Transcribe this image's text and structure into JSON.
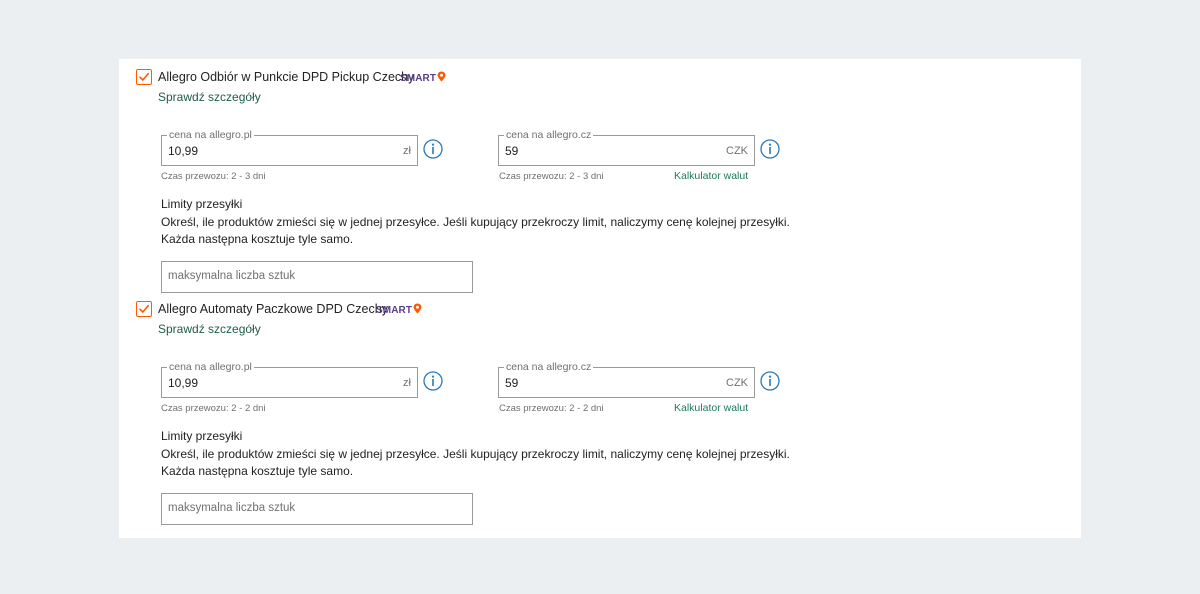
{
  "colors": {
    "accent_checkbox": "#ff5a00",
    "link_green": "#1f5c4a",
    "calc_link_green": "#1f7a5c",
    "info_icon_blue": "#2a7ab8",
    "smart_purple": "#5a3e8a",
    "page_bg": "#eceff2"
  },
  "shipping_methods": [
    {
      "checked": true,
      "title": "Allegro Odbiór w Punkcie DPD Pickup Czechy",
      "badge": "SMART",
      "details_link": "Sprawdź szczegóły",
      "price_pl": {
        "legend": "cena na allegro.pl",
        "value": "10,99",
        "unit": "zł",
        "transit": "Czas przewozu: 2 - 3 dni"
      },
      "price_cz": {
        "legend": "cena na allegro.cz",
        "value": "59",
        "unit": "CZK",
        "transit": "Czas przewozu: 2 - 3 dni",
        "calculator_link": "Kalkulator walut"
      },
      "limits": {
        "title": "Limity przesyłki",
        "line1": "Określ, ile produktów zmieści się w jednej przesyłce. Jeśli kupujący przekroczy limit, naliczymy cenę kolejnej przesyłki.",
        "line2": "Każda następna kosztuje tyle samo.",
        "max_placeholder": "maksymalna liczba sztuk"
      }
    },
    {
      "checked": true,
      "title": "Allegro Automaty Paczkowe DPD Czechy",
      "badge": "SMART",
      "details_link": "Sprawdź szczegóły",
      "price_pl": {
        "legend": "cena na allegro.pl",
        "value": "10,99",
        "unit": "zł",
        "transit": "Czas przewozu: 2 - 2 dni"
      },
      "price_cz": {
        "legend": "cena na allegro.cz",
        "value": "59",
        "unit": "CZK",
        "transit": "Czas przewozu: 2 - 2 dni",
        "calculator_link": "Kalkulator walut"
      },
      "limits": {
        "title": "Limity przesyłki",
        "line1": "Określ, ile produktów zmieści się w jednej przesyłce. Jeśli kupujący przekroczy limit, naliczymy cenę kolejnej przesyłki.",
        "line2": "Każda następna kosztuje tyle samo.",
        "max_placeholder": "maksymalna liczba sztuk"
      }
    }
  ]
}
